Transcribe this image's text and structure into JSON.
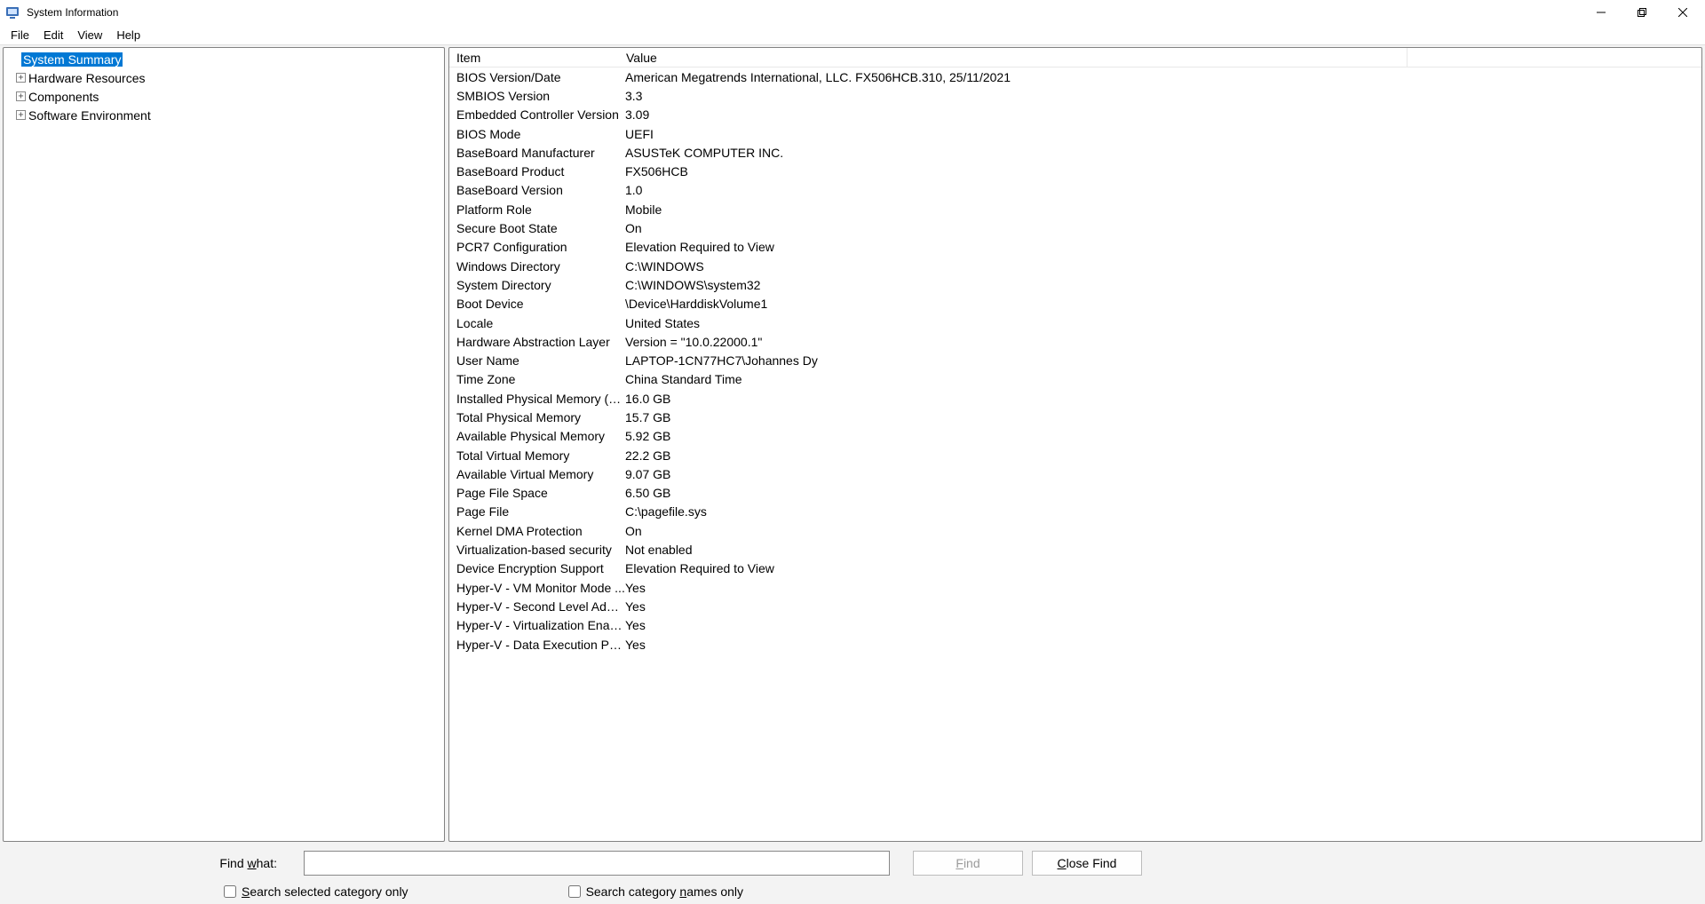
{
  "window": {
    "title": "System Information"
  },
  "menu": {
    "items": [
      "File",
      "Edit",
      "View",
      "Help"
    ]
  },
  "tree": {
    "root": "System Summary",
    "children": [
      "Hardware Resources",
      "Components",
      "Software Environment"
    ]
  },
  "columns": {
    "item": "Item",
    "value": "Value"
  },
  "rows": [
    {
      "item": "BIOS Version/Date",
      "value": "American Megatrends International, LLC. FX506HCB.310, 25/11/2021"
    },
    {
      "item": "SMBIOS Version",
      "value": "3.3"
    },
    {
      "item": "Embedded Controller Version",
      "value": "3.09"
    },
    {
      "item": "BIOS Mode",
      "value": "UEFI"
    },
    {
      "item": "BaseBoard Manufacturer",
      "value": "ASUSTeK COMPUTER INC."
    },
    {
      "item": "BaseBoard Product",
      "value": "FX506HCB"
    },
    {
      "item": "BaseBoard Version",
      "value": "1.0"
    },
    {
      "item": "Platform Role",
      "value": "Mobile"
    },
    {
      "item": "Secure Boot State",
      "value": "On"
    },
    {
      "item": "PCR7 Configuration",
      "value": "Elevation Required to View"
    },
    {
      "item": "Windows Directory",
      "value": "C:\\WINDOWS"
    },
    {
      "item": "System Directory",
      "value": "C:\\WINDOWS\\system32"
    },
    {
      "item": "Boot Device",
      "value": "\\Device\\HarddiskVolume1"
    },
    {
      "item": "Locale",
      "value": "United States"
    },
    {
      "item": "Hardware Abstraction Layer",
      "value": "Version = \"10.0.22000.1\""
    },
    {
      "item": "User Name",
      "value": "LAPTOP-1CN77HC7\\Johannes Dy"
    },
    {
      "item": "Time Zone",
      "value": "China Standard Time"
    },
    {
      "item": "Installed Physical Memory (RA...",
      "value": "16.0 GB"
    },
    {
      "item": "Total Physical Memory",
      "value": "15.7 GB"
    },
    {
      "item": "Available Physical Memory",
      "value": "5.92 GB"
    },
    {
      "item": "Total Virtual Memory",
      "value": "22.2 GB"
    },
    {
      "item": "Available Virtual Memory",
      "value": "9.07 GB"
    },
    {
      "item": "Page File Space",
      "value": "6.50 GB"
    },
    {
      "item": "Page File",
      "value": "C:\\pagefile.sys"
    },
    {
      "item": "Kernel DMA Protection",
      "value": "On"
    },
    {
      "item": "Virtualization-based security",
      "value": "Not enabled"
    },
    {
      "item": "Device Encryption Support",
      "value": "Elevation Required to View"
    },
    {
      "item": "Hyper-V - VM Monitor Mode ...",
      "value": "Yes"
    },
    {
      "item": "Hyper-V - Second Level Addre...",
      "value": "Yes"
    },
    {
      "item": "Hyper-V - Virtualization Enabl...",
      "value": "Yes"
    },
    {
      "item": "Hyper-V - Data Execution Pro...",
      "value": "Yes"
    }
  ],
  "find": {
    "label_prefix": "Find ",
    "label_underline": "w",
    "label_suffix": "hat:",
    "value": "",
    "find_button": "Find",
    "close_button_underline": "C",
    "close_button_rest": "lose Find",
    "check1_underline": "S",
    "check1_rest": "earch selected category only",
    "check2_prefix": "Search category ",
    "check2_underline": "n",
    "check2_suffix": "ames only"
  }
}
